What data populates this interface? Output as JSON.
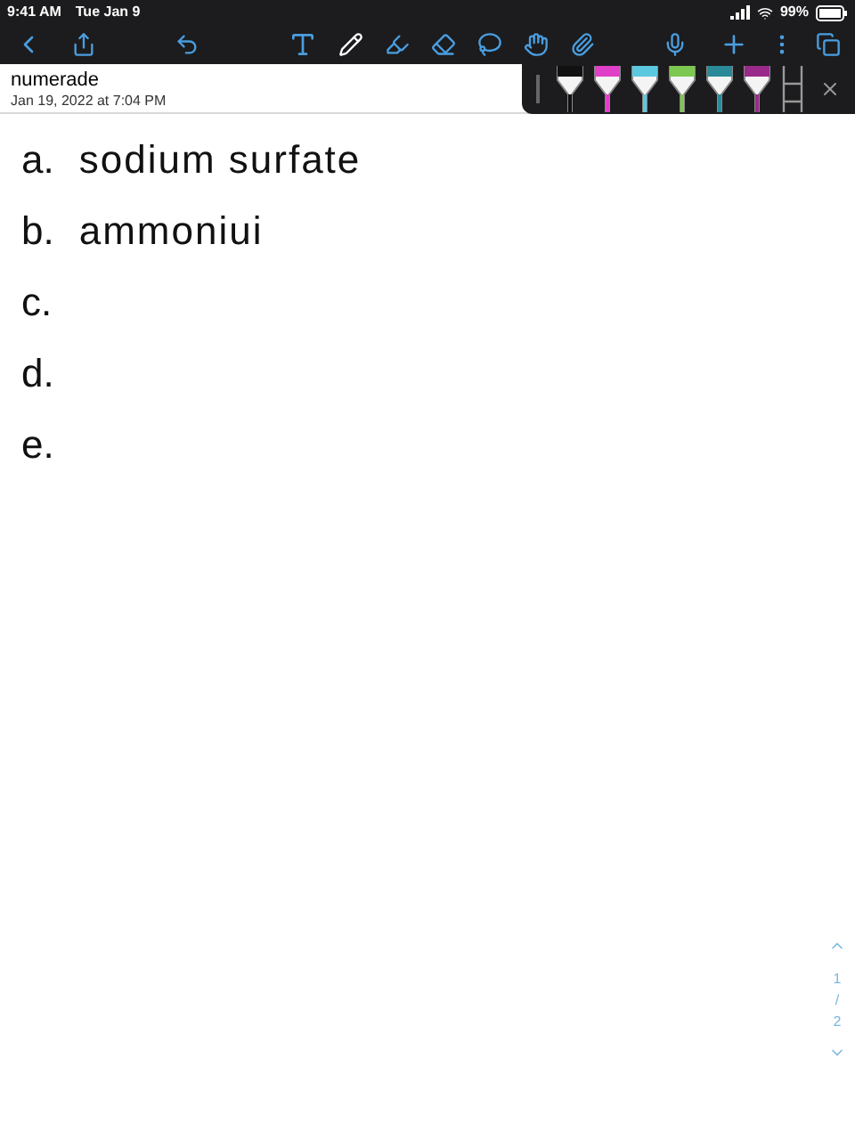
{
  "status_bar": {
    "time": "9:41 AM",
    "date": "Tue Jan 9",
    "battery": "99%"
  },
  "note": {
    "title": "numerade",
    "date": "Jan 19, 2022 at 7:04 PM"
  },
  "pens": [
    {
      "color": "#111111"
    },
    {
      "color": "#e040c8"
    },
    {
      "color": "#5cc8e0"
    },
    {
      "color": "#7cc850"
    },
    {
      "color": "#2a8a98"
    },
    {
      "color": "#9a2a8a"
    }
  ],
  "lines": [
    {
      "marker": "a.",
      "text": "sodium surfate"
    },
    {
      "marker": "b.",
      "text": "ammoniui"
    },
    {
      "marker": "c."
    },
    {
      "marker": "d."
    },
    {
      "marker": "e."
    }
  ],
  "pager": {
    "current": "1",
    "divider": "/",
    "total": "2"
  }
}
